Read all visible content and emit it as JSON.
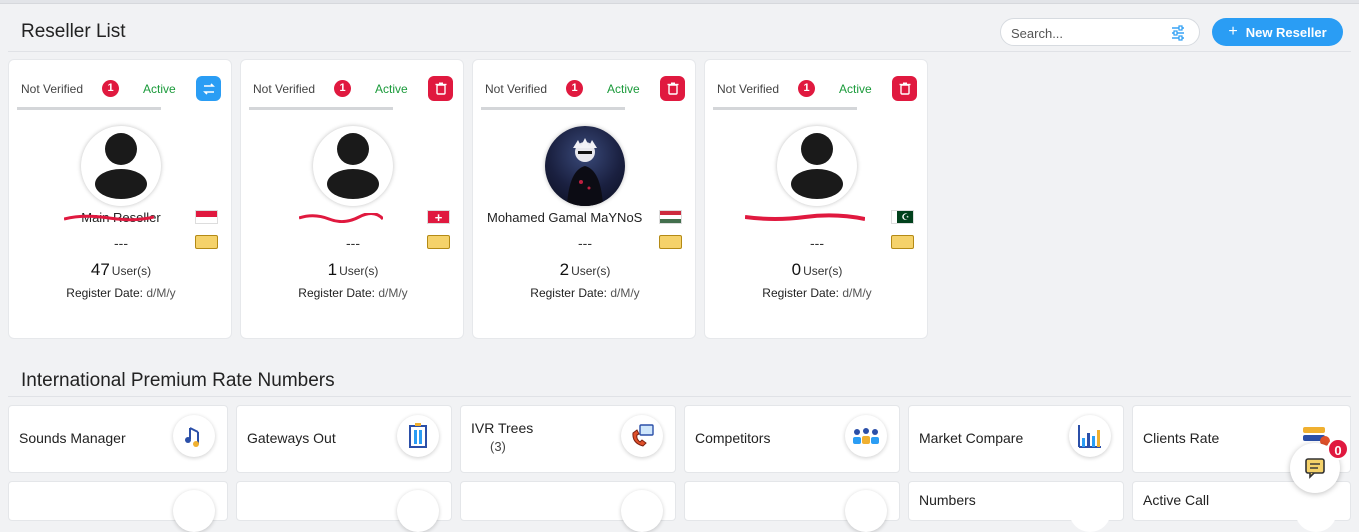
{
  "header": {
    "title": "Reseller List",
    "search_placeholder": "Search...",
    "new_button_label": "New Reseller",
    "accent": "#2a9df4"
  },
  "resellers": [
    {
      "verification": "Not Verified",
      "badge": "1",
      "status": "Active",
      "action_icon": "transfer-icon",
      "name": "Main Reseller",
      "flag": "indonesia-flag",
      "phone": "---",
      "users_count": "47",
      "users_label": "User(s)",
      "register_label": "Register Date:",
      "register_value": "d/M/y"
    },
    {
      "verification": "Not Verified",
      "badge": "1",
      "status": "Active",
      "action_icon": "trash-icon",
      "name": "",
      "flag": "switzerland-flag",
      "phone": "---",
      "users_count": "1",
      "users_label": "User(s)",
      "register_label": "Register Date:",
      "register_value": "d/M/y"
    },
    {
      "verification": "Not Verified",
      "badge": "1",
      "status": "Active",
      "action_icon": "trash-icon",
      "name": "Mohamed Gamal MaYNoS",
      "flag": "hungary-flag",
      "phone": "---",
      "users_count": "2",
      "users_label": "User(s)",
      "register_label": "Register Date:",
      "register_value": "d/M/y"
    },
    {
      "verification": "Not Verified",
      "badge": "1",
      "status": "Active",
      "action_icon": "trash-icon",
      "name": "",
      "flag": "pakistan-flag",
      "phone": "---",
      "users_count": "0",
      "users_label": "User(s)",
      "register_label": "Register Date:",
      "register_value": "d/M/y"
    }
  ],
  "section": {
    "title": "International Premium Rate Numbers",
    "tiles": [
      {
        "label": "Sounds Manager",
        "sub": "",
        "icon": "music-notes-icon"
      },
      {
        "label": "Gateways Out",
        "sub": "",
        "icon": "gateway-door-icon"
      },
      {
        "label": "IVR Trees",
        "sub": "(3)",
        "icon": "phone-chat-icon"
      },
      {
        "label": "Competitors",
        "sub": "",
        "icon": "people-group-icon"
      },
      {
        "label": "Market Compare",
        "sub": "",
        "icon": "bar-chart-icon"
      },
      {
        "label": "Clients Rate",
        "sub": "",
        "icon": "rate-cards-icon"
      }
    ],
    "tiles_row2": [
      {
        "label": "",
        "icon": "clipboard-icon"
      },
      {
        "label": "",
        "icon": "phone-arrow-icon"
      },
      {
        "label": "",
        "icon": "ticket-icon"
      },
      {
        "label": "",
        "icon": "document-icon"
      },
      {
        "label": "Numbers",
        "icon": "list-card-icon"
      },
      {
        "label": "Active Call",
        "icon": "call-forward-icon"
      }
    ]
  },
  "chat": {
    "badge": "0"
  }
}
